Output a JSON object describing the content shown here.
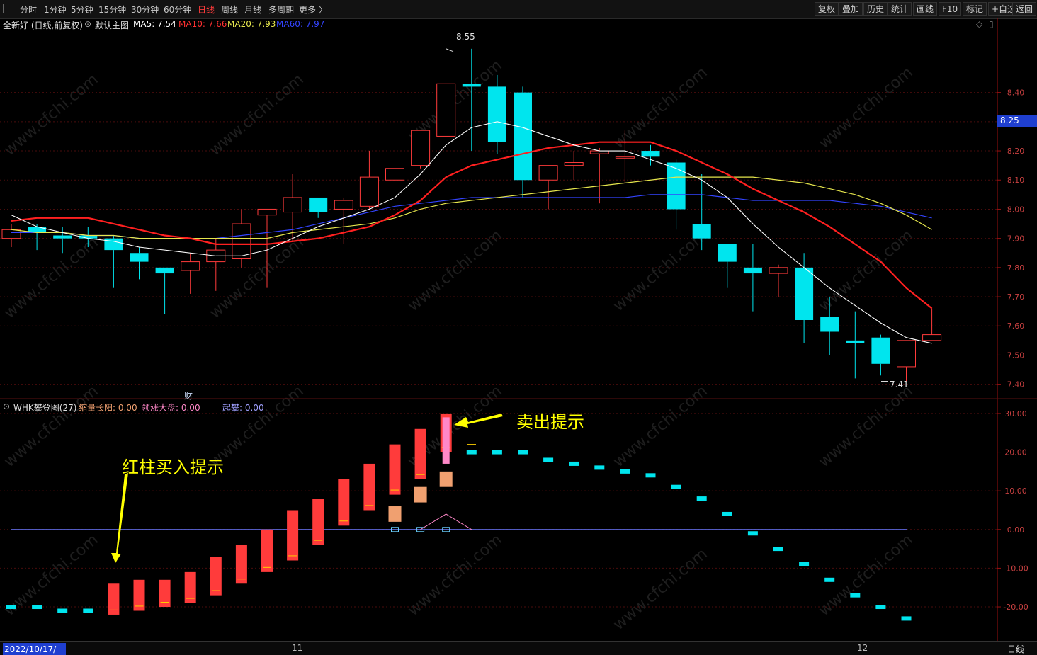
{
  "toolbar": {
    "left": [
      "分时",
      "1分钟",
      "5分钟",
      "15分钟",
      "30分钟",
      "60分钟",
      "日线",
      "周线",
      "月线",
      "多周期",
      "更多 〉"
    ],
    "active": "日线",
    "right": [
      "复权",
      "叠加",
      "历史",
      "统计",
      "画线",
      "F10",
      "标记",
      "+自选",
      "返回"
    ]
  },
  "main_info": {
    "stock": "全新好 (日线,前复权)",
    "chart_label": "默认主图",
    "ma5": "MA5: 7.54",
    "ma10": "MA10: 7.66",
    "ma20": "MA20: 7.93",
    "ma60": "MA60: 7.97"
  },
  "indicator_info": {
    "name": "WHK攀登图(27)",
    "s1": "缩量长阳: 0.00",
    "s2": "领涨大盘: 0.00",
    "s3": "起攀: 0.00"
  },
  "annotations": {
    "buy": "红柱买入提示",
    "sell": "卖出提示",
    "high": "8.55",
    "low": "7.41",
    "fin": "财",
    "current_price": "8.25"
  },
  "bottom": {
    "date": "2022/10/17/一",
    "m11": "11",
    "m12": "12",
    "period": "日线"
  },
  "watermark": "www.cfchi.com",
  "colors": {
    "up": "#ff3b3b",
    "down": "#00e5ee",
    "ma5": "#ffffff",
    "ma10": "#ff2020",
    "ma20": "#e6e64d",
    "ma60": "#3344ff",
    "axis": "#9a1010",
    "orange": "#f0a070",
    "pink": "#ff88c8"
  },
  "chart_data": [
    {
      "type": "candlestick",
      "ylim": [
        7.37,
        8.62
      ],
      "yticks": [
        7.4,
        7.5,
        7.6,
        7.7,
        7.8,
        7.9,
        8.0,
        8.1,
        8.2,
        8.3,
        8.4
      ],
      "ytick_labels": [
        "7.40",
        "7.50",
        "7.60",
        "7.70",
        "7.80",
        "7.90",
        "8.00",
        "8.10",
        "8.20",
        "8.30",
        "8.40"
      ],
      "candles": [
        {
          "o": 7.9,
          "h": 7.95,
          "l": 7.87,
          "c": 7.93
        },
        {
          "o": 7.94,
          "h": 7.95,
          "l": 7.86,
          "c": 7.92
        },
        {
          "o": 7.91,
          "h": 7.94,
          "l": 7.85,
          "c": 7.9
        },
        {
          "o": 7.91,
          "h": 7.94,
          "l": 7.87,
          "c": 7.9
        },
        {
          "o": 7.9,
          "h": 7.91,
          "l": 7.73,
          "c": 7.86
        },
        {
          "o": 7.85,
          "h": 7.87,
          "l": 7.76,
          "c": 7.82
        },
        {
          "o": 7.8,
          "h": 7.8,
          "l": 7.64,
          "c": 7.78
        },
        {
          "o": 7.79,
          "h": 7.85,
          "l": 7.71,
          "c": 7.82
        },
        {
          "o": 7.82,
          "h": 7.9,
          "l": 7.72,
          "c": 7.86
        },
        {
          "o": 7.83,
          "h": 8.0,
          "l": 7.8,
          "c": 7.95
        },
        {
          "o": 7.98,
          "h": 7.98,
          "l": 7.73,
          "c": 8.0
        },
        {
          "o": 7.99,
          "h": 8.12,
          "l": 7.89,
          "c": 8.04
        },
        {
          "o": 8.04,
          "h": 8.04,
          "l": 7.97,
          "c": 7.99
        },
        {
          "o": 8.0,
          "h": 8.04,
          "l": 7.88,
          "c": 8.03
        },
        {
          "o": 8.01,
          "h": 8.2,
          "l": 8.0,
          "c": 8.11
        },
        {
          "o": 8.1,
          "h": 8.15,
          "l": 8.05,
          "c": 8.14
        },
        {
          "o": 8.15,
          "h": 8.26,
          "l": 8.14,
          "c": 8.27
        },
        {
          "o": 8.25,
          "h": 8.43,
          "l": 8.25,
          "c": 8.43
        },
        {
          "o": 8.43,
          "h": 8.55,
          "l": 8.2,
          "c": 8.42
        },
        {
          "o": 8.42,
          "h": 8.46,
          "l": 8.19,
          "c": 8.23
        },
        {
          "o": 8.4,
          "h": 8.42,
          "l": 8.04,
          "c": 8.1
        },
        {
          "o": 8.1,
          "h": 8.15,
          "l": 8.0,
          "c": 8.15
        },
        {
          "o": 8.15,
          "h": 8.2,
          "l": 8.1,
          "c": 8.16
        },
        {
          "o": 8.19,
          "h": 8.21,
          "l": 8.02,
          "c": 8.2
        },
        {
          "o": 8.18,
          "h": 8.27,
          "l": 8.09,
          "c": 8.18
        },
        {
          "o": 8.2,
          "h": 8.22,
          "l": 8.15,
          "c": 8.18
        },
        {
          "o": 8.16,
          "h": 8.17,
          "l": 7.93,
          "c": 8.0
        },
        {
          "o": 7.95,
          "h": 8.12,
          "l": 7.86,
          "c": 7.9
        },
        {
          "o": 7.88,
          "h": 7.88,
          "l": 7.73,
          "c": 7.82
        },
        {
          "o": 7.8,
          "h": 7.88,
          "l": 7.65,
          "c": 7.78
        },
        {
          "o": 7.78,
          "h": 7.81,
          "l": 7.7,
          "c": 7.8
        },
        {
          "o": 7.8,
          "h": 7.85,
          "l": 7.54,
          "c": 7.62
        },
        {
          "o": 7.63,
          "h": 7.7,
          "l": 7.5,
          "c": 7.58
        },
        {
          "o": 7.55,
          "h": 7.65,
          "l": 7.42,
          "c": 7.54
        },
        {
          "o": 7.56,
          "h": 7.57,
          "l": 7.43,
          "c": 7.47
        },
        {
          "o": 7.46,
          "h": 7.55,
          "l": 7.41,
          "c": 7.55
        },
        {
          "o": 7.55,
          "h": 7.66,
          "l": 7.55,
          "c": 7.57
        }
      ],
      "ma5": [
        7.98,
        7.94,
        7.92,
        7.9,
        7.89,
        7.87,
        7.86,
        7.85,
        7.84,
        7.84,
        7.86,
        7.9,
        7.94,
        7.97,
        8.0,
        8.04,
        8.12,
        8.22,
        8.28,
        8.3,
        8.28,
        8.25,
        8.22,
        8.2,
        8.2,
        8.17,
        8.14,
        8.1,
        8.04,
        7.95,
        7.87,
        7.8,
        7.73,
        7.67,
        7.61,
        7.56,
        7.54
      ],
      "ma10": [
        7.96,
        7.97,
        7.97,
        7.97,
        7.95,
        7.93,
        7.91,
        7.9,
        7.88,
        7.88,
        7.88,
        7.89,
        7.9,
        7.92,
        7.94,
        7.98,
        8.03,
        8.11,
        8.15,
        8.17,
        8.19,
        8.21,
        8.22,
        8.23,
        8.23,
        8.23,
        8.2,
        8.16,
        8.12,
        8.07,
        8.03,
        7.99,
        7.94,
        7.88,
        7.82,
        7.73,
        7.66
      ],
      "ma20": [
        7.93,
        7.92,
        7.92,
        7.91,
        7.91,
        7.9,
        7.9,
        7.9,
        7.9,
        7.9,
        7.9,
        7.92,
        7.93,
        7.94,
        7.95,
        7.97,
        8.0,
        8.02,
        8.03,
        8.04,
        8.05,
        8.06,
        8.07,
        8.08,
        8.09,
        8.1,
        8.11,
        8.11,
        8.11,
        8.11,
        8.1,
        8.09,
        8.07,
        8.05,
        8.02,
        7.98,
        7.93
      ],
      "ma60": [
        7.92,
        7.92,
        7.92,
        7.91,
        7.91,
        7.9,
        7.9,
        7.9,
        7.9,
        7.91,
        7.92,
        7.93,
        7.95,
        7.97,
        7.99,
        8.01,
        8.02,
        8.03,
        8.04,
        8.04,
        8.04,
        8.04,
        8.04,
        8.04,
        8.04,
        8.05,
        8.05,
        8.05,
        8.04,
        8.03,
        8.03,
        8.03,
        8.03,
        8.02,
        8.01,
        7.99,
        7.97
      ]
    },
    {
      "type": "bar",
      "name": "WHK攀登图(27)",
      "ylim": [
        -27.5,
        32
      ],
      "yticks": [
        30,
        20,
        10,
        0,
        -10,
        -20
      ],
      "ytick_labels": [
        "30.00",
        "20.00",
        "10.00",
        "0.00",
        "-10.00",
        "-20.00"
      ],
      "red_bars": [
        [
          4,
          -22,
          -14
        ],
        [
          5,
          -21,
          -13
        ],
        [
          6,
          -20,
          -13
        ],
        [
          7,
          -19,
          -11
        ],
        [
          8,
          -17,
          -7
        ],
        [
          9,
          -14,
          -4
        ],
        [
          10,
          -11,
          0
        ],
        [
          11,
          -8,
          5
        ],
        [
          12,
          -4,
          8
        ],
        [
          13,
          1,
          13
        ],
        [
          14,
          5,
          17
        ],
        [
          15,
          9,
          22
        ],
        [
          16,
          13,
          26
        ],
        [
          17,
          20,
          30
        ]
      ],
      "pink_bars": [
        [
          17,
          17,
          29
        ]
      ],
      "orange_boxes": [
        [
          15,
          2,
          6
        ],
        [
          16,
          7,
          11
        ],
        [
          17,
          11,
          15
        ]
      ],
      "cyan_dashes": [
        [
          0,
          -20
        ],
        [
          1,
          -20
        ],
        [
          2,
          -21
        ],
        [
          3,
          -21
        ],
        [
          18,
          20
        ],
        [
          19,
          20
        ],
        [
          20,
          20
        ],
        [
          21,
          18
        ],
        [
          22,
          17
        ],
        [
          23,
          16
        ],
        [
          24,
          15
        ],
        [
          25,
          14
        ],
        [
          26,
          11
        ],
        [
          27,
          8
        ],
        [
          28,
          4
        ],
        [
          29,
          -1
        ],
        [
          30,
          -5
        ],
        [
          31,
          -9
        ],
        [
          32,
          -13
        ],
        [
          33,
          -17
        ],
        [
          34,
          -20
        ],
        [
          35,
          -23
        ]
      ],
      "zero_boxes": [
        15,
        16,
        17
      ],
      "pink_triangle": [
        [
          16,
          0
        ],
        [
          17,
          4
        ],
        [
          18,
          0
        ]
      ]
    }
  ]
}
